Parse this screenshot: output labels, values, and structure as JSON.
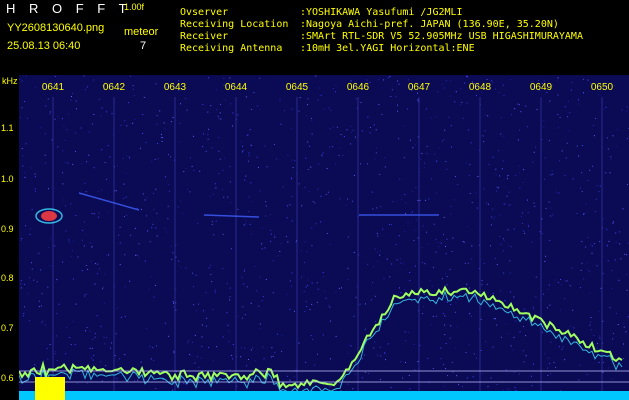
{
  "header": {
    "brand": "H R O F F T",
    "version": "1.00f",
    "filename": "YY2608130640.png",
    "timestamp": "25.08.13 06:40",
    "meteor_label": "meteor",
    "meteor_count": "7"
  },
  "meta": [
    {
      "label": "Ovserver",
      "value": ":YOSHIKAWA Yasufumi /JG2MLI"
    },
    {
      "label": "Receiving Location",
      "value": ":Nagoya Aichi-pref. JAPAN (136.90E, 35.20N)"
    },
    {
      "label": "Receiver",
      "value": ":SMArt RTL-SDR V5 52.905MHz USB HIGASHIMURAYAMA"
    },
    {
      "label": "Receiving Antenna",
      "value": ":10mH 3el.YAGI Horizontal:ENE"
    }
  ],
  "axis": {
    "unit": "kHz",
    "y_ticks": [
      "1.1",
      "1.0",
      "0.9",
      "0.8",
      "0.7",
      "0.6"
    ],
    "time_ticks": [
      "0641",
      "0642",
      "0643",
      "0644",
      "0645",
      "0646",
      "0647",
      "0648",
      "0649",
      "0650"
    ]
  },
  "colors": {
    "text_white": "#ffffff",
    "text_yellow": "#ffff00",
    "background_noise": "#14147a",
    "signal_cyan": "#40e0ff",
    "signal_green": "#a0ff60",
    "meteor_red": "#ff4040",
    "baseline_fill": "#00c8ff",
    "baseline_peak": "#ffff00"
  }
}
